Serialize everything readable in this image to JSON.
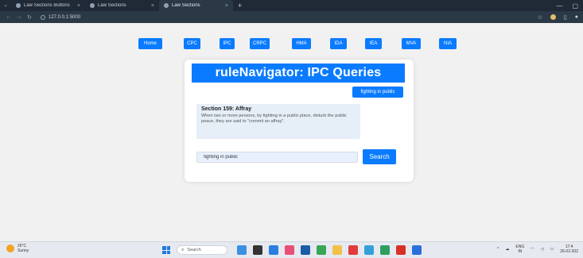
{
  "browser": {
    "tabs": [
      {
        "label": "Law Sections Buttons",
        "active": false
      },
      {
        "label": "Law Sections",
        "active": false
      },
      {
        "label": "Law Sections",
        "active": true
      }
    ],
    "new_tab_icon": "plus-icon",
    "url": "127.0.0.1:5000",
    "window_controls": [
      "minimize-icon",
      "maximize-icon"
    ]
  },
  "nav": {
    "buttons": [
      "Home",
      "CPC",
      "IPC",
      "CRPC",
      "HMA",
      "IDA",
      "IEA",
      "MVA",
      "NIA"
    ]
  },
  "main": {
    "title": "ruleNavigator: IPC Queries",
    "query_chip": "fighting in public",
    "result": {
      "title": "Section 159: Affray",
      "body": "When two or more persons, by fighting in a public place, disturb the public peace, they are said to \"commit an affray\"."
    },
    "search": {
      "value": "fighting in public",
      "button_label": "Search"
    }
  },
  "taskbar": {
    "weather_temp": "26°C",
    "weather_desc": "Sunny",
    "search_placeholder": "Search",
    "lang_top": "ENG",
    "lang_bottom": "IN",
    "time": "17:4",
    "date": "26-02-202"
  },
  "colors": {
    "accent": "#0a7bff",
    "result_bg": "#e6eef8",
    "page_bg": "#f1f1f1",
    "chrome_dark": "#1f2a36"
  }
}
